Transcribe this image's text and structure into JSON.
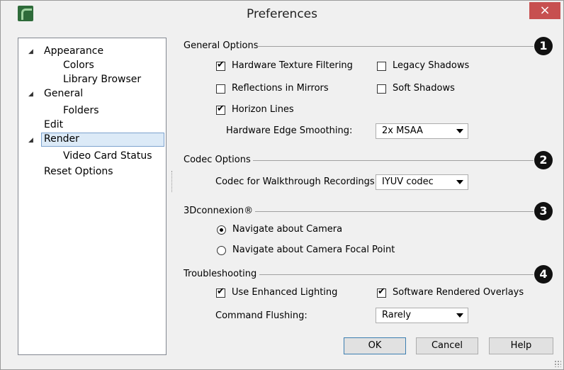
{
  "window": {
    "title": "Preferences",
    "close_glyph": "×",
    "icon": "app-logo-icon"
  },
  "tree": {
    "items": [
      {
        "label": "Appearance",
        "expander": "◢"
      },
      {
        "label": "Colors"
      },
      {
        "label": "Library Browser"
      },
      {
        "label": "General",
        "expander": "◢"
      },
      {
        "label": "Folders"
      },
      {
        "label": "Edit"
      },
      {
        "label": "Render",
        "expander": "◢",
        "selected": true
      },
      {
        "label": "Video Card Status"
      },
      {
        "label": "Reset Options"
      }
    ]
  },
  "general_options": {
    "title": "General Options",
    "badge": "1",
    "hardware_texture_filtering": {
      "label": "Hardware Texture Filtering",
      "checked": true
    },
    "legacy_shadows": {
      "label": "Legacy Shadows",
      "checked": false
    },
    "reflections_in_mirrors": {
      "label": "Reflections in Mirrors",
      "checked": false
    },
    "soft_shadows": {
      "label": "Soft Shadows",
      "checked": false
    },
    "horizon_lines": {
      "label": "Horizon Lines",
      "checked": true
    },
    "edge_smoothing": {
      "label": "Hardware Edge Smoothing:",
      "value": "2x MSAA"
    }
  },
  "codec_options": {
    "title": "Codec Options",
    "badge": "2",
    "codec": {
      "label": "Codec for Walkthrough Recordings:",
      "value": "IYUV codec"
    }
  },
  "connexion": {
    "title": "3Dconnexion®",
    "badge": "3",
    "navigate_camera": {
      "label": "Navigate about Camera",
      "selected": true
    },
    "navigate_focal": {
      "label": "Navigate about Camera Focal Point",
      "selected": false
    }
  },
  "troubleshooting": {
    "title": "Troubleshooting",
    "badge": "4",
    "enhanced_lighting": {
      "label": "Use Enhanced Lighting",
      "checked": true
    },
    "software_overlays": {
      "label": "Software Rendered Overlays",
      "checked": true
    },
    "command_flushing": {
      "label": "Command Flushing:",
      "value": "Rarely"
    }
  },
  "buttons": {
    "ok": "OK",
    "cancel": "Cancel",
    "help": "Help"
  },
  "colors": {
    "close_button": "#c75050",
    "selection": "#dceaf7",
    "selection_border": "#7da2ce",
    "badge": "#111111"
  }
}
